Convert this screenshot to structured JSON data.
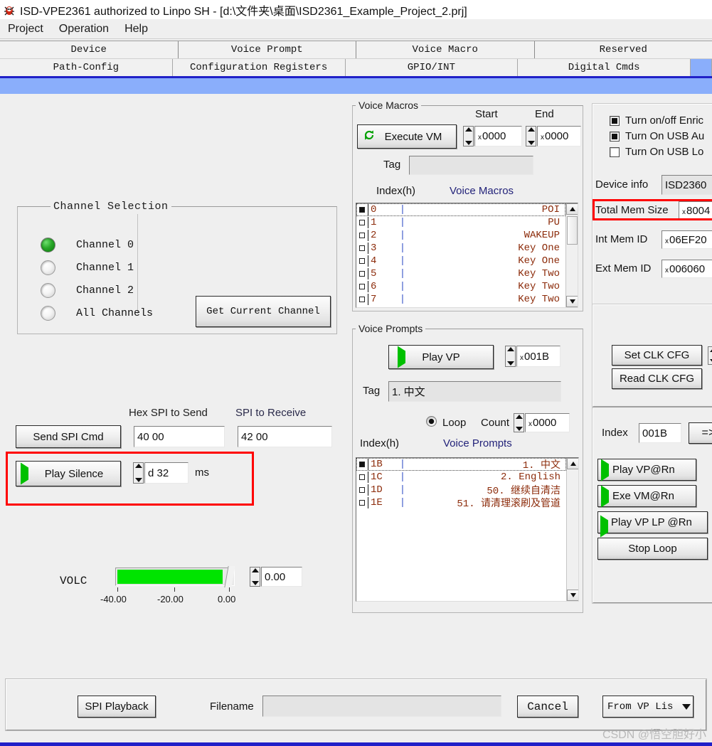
{
  "window": {
    "title": "ISD-VPE2361 authorized to Linpo SH - [d:\\文件夹\\桌面\\ISD2361_Example_Project_2.prj]",
    "icon": "app-bug-icon"
  },
  "menubar": {
    "items": [
      "Project",
      "Operation",
      "Help"
    ]
  },
  "tabs": {
    "row1": [
      "Device",
      "Voice Prompt",
      "Voice Macro",
      "Reserved"
    ],
    "row2": [
      "Path-Config",
      "Configuration Registers",
      "GPIO/INT",
      "Digital Cmds",
      ""
    ],
    "row2_selected_index": 4
  },
  "channel_selection": {
    "title": "Channel Selection",
    "options": [
      "Channel 0",
      "Channel 1",
      "Channel 2",
      "All Channels"
    ],
    "selected_index": 0,
    "get_current_button": "Get Current Channel"
  },
  "spi": {
    "hex_to_send_label": "Hex SPI to Send",
    "to_receive_label": "SPI to Receive",
    "send_button": "Send SPI Cmd",
    "hex_to_send_value": "40 00",
    "to_receive_value": "42 00",
    "play_silence_button": "Play Silence",
    "silence_value": "d 32",
    "silence_units": "ms"
  },
  "volc": {
    "label": "VOLC",
    "value": "0.00",
    "ticks": [
      "-40.00",
      "-20.00",
      "0.00"
    ],
    "fill_color": "#00e400"
  },
  "voice_macros": {
    "title": "Voice Macros",
    "execute_button": "Execute VM",
    "execute_icon": "refresh-icon",
    "start_label": "Start",
    "end_label": "End",
    "start_value": "0000",
    "end_value": "0000",
    "hex_prefix": "x",
    "tag_label": "Tag",
    "tag_value": "",
    "index_header": "Index(h)",
    "list_header": "Voice Macros",
    "rows": [
      {
        "index": "0",
        "name": "POI",
        "selected": true
      },
      {
        "index": "1",
        "name": "PU",
        "selected": false
      },
      {
        "index": "2",
        "name": "WAKEUP",
        "selected": false
      },
      {
        "index": "3",
        "name": "Key One",
        "selected": false
      },
      {
        "index": "4",
        "name": "Key One",
        "selected": false
      },
      {
        "index": "5",
        "name": "Key Two",
        "selected": false
      },
      {
        "index": "6",
        "name": "Key Two",
        "selected": false
      },
      {
        "index": "7",
        "name": "Key Two",
        "selected": false
      }
    ]
  },
  "voice_prompts": {
    "title": "Voice Prompts",
    "play_button": "Play VP",
    "play_icon": "play-icon",
    "index_value": "001B",
    "hex_prefix": "x",
    "tag_label": "Tag",
    "tag_value": "1. 中文",
    "loop_label": "Loop",
    "count_label": "Count",
    "count_value": "0000",
    "loop_checked": true,
    "index_header": "Index(h)",
    "list_header": "Voice Prompts",
    "rows": [
      {
        "index": "1B",
        "name": "1. 中文",
        "selected": true
      },
      {
        "index": "1C",
        "name": "2. English",
        "selected": false
      },
      {
        "index": "1D",
        "name": "50. 继续自清洁",
        "selected": false
      },
      {
        "index": "1E",
        "name": "51. 请清理滚刷及管道",
        "selected": false
      }
    ]
  },
  "device_panel": {
    "checkboxes": [
      {
        "label": "Turn on/off Enric",
        "checked": true
      },
      {
        "label": "Turn On USB Au",
        "checked": true
      },
      {
        "label": "Turn On USB Lo",
        "checked": false
      }
    ],
    "device_info_label": "Device info",
    "device_info_value": "ISD2360",
    "total_mem_label": "Total Mem Size",
    "total_mem_value": "8004",
    "int_mem_label": "Int Mem ID",
    "int_mem_value": "06EF20",
    "ext_mem_label": "Ext Mem ID",
    "ext_mem_value": "006060",
    "hex_prefix": "x"
  },
  "clk_panel": {
    "set_button": "Set CLK CFG",
    "read_button": "Read CLK CFG"
  },
  "rn_panel": {
    "index_label": "Index",
    "index_value": "001B",
    "arrow_button": "=>",
    "buttons": [
      {
        "label": "Play VP@Rn",
        "icon": "play-icon"
      },
      {
        "label": "Exe VM@Rn",
        "icon": "play-icon"
      },
      {
        "label": "Play VP LP @Rn",
        "icon": "play-icon"
      },
      {
        "label": "Stop Loop",
        "icon": ""
      }
    ]
  },
  "bottom_bar": {
    "spi_playback_button": "SPI Playback",
    "filename_label": "Filename",
    "filename_value": "",
    "cancel_button": "Cancel",
    "source_combo_value": "From VP Lis"
  },
  "watermark": "CSDN @悟空胆好小",
  "colors": {
    "accent_blue": "#8aaefb",
    "deep_blue": "#2020c8",
    "highlight_red": "#ff0000",
    "green": "#00c000",
    "window_bg": "#efefef"
  }
}
